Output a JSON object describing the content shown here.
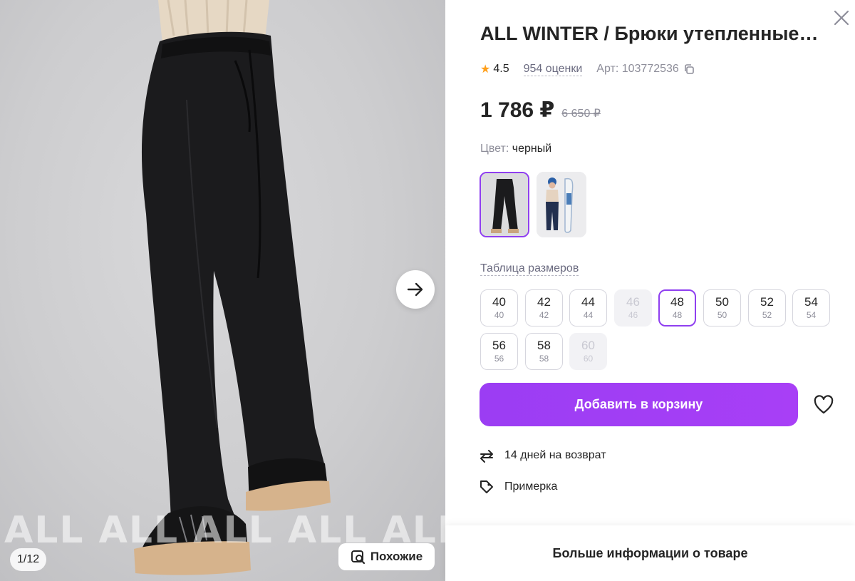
{
  "gallery": {
    "watermark": "ALL ALL ALL ALL ALL ALL ALL",
    "counter": "1/12",
    "similar_label": "Похожие"
  },
  "product": {
    "title": "ALL WINTER / Брюки утепленные…",
    "rating": "4.5",
    "reviews": "954 оценки",
    "article": "Арт: 103772536",
    "price": "1 786 ₽",
    "old_price": "6 650 ₽",
    "color_label": "Цвет:",
    "color_value": "черный",
    "size_table_link": "Таблица размеров",
    "sizes": [
      {
        "n": "40",
        "r": "40",
        "state": "available"
      },
      {
        "n": "42",
        "r": "42",
        "state": "available"
      },
      {
        "n": "44",
        "r": "44",
        "state": "available"
      },
      {
        "n": "46",
        "r": "46",
        "state": "disabled"
      },
      {
        "n": "48",
        "r": "48",
        "state": "selected"
      },
      {
        "n": "50",
        "r": "50",
        "state": "available"
      },
      {
        "n": "52",
        "r": "52",
        "state": "available"
      },
      {
        "n": "54",
        "r": "54",
        "state": "available"
      },
      {
        "n": "56",
        "r": "56",
        "state": "available"
      },
      {
        "n": "58",
        "r": "58",
        "state": "available"
      },
      {
        "n": "60",
        "r": "60",
        "state": "disabled"
      }
    ],
    "add_to_cart": "Добавить в корзину",
    "return_text": "14 дней на возврат",
    "fitting_text": "Примерка",
    "more_info": "Больше информации о товаре"
  },
  "colors": {
    "accent": "#a13bf5",
    "selected_border": "#8f3ff0",
    "star": "#ff9f1a"
  },
  "icons": [
    "arrow-right-icon",
    "search-similar-icon",
    "close-icon",
    "star-icon",
    "copy-icon",
    "heart-icon",
    "return-icon",
    "tag-icon"
  ]
}
